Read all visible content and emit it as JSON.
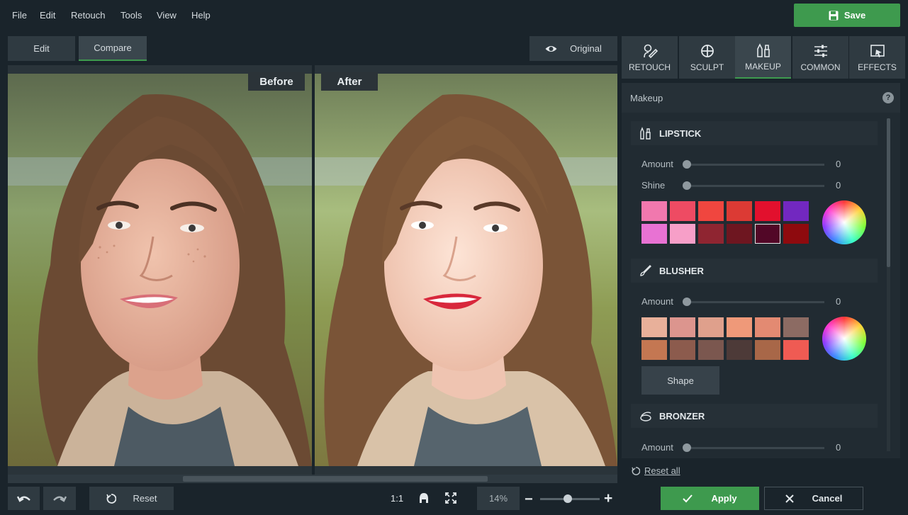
{
  "menu": [
    "File",
    "Edit",
    "Retouch",
    "Tools",
    "View",
    "Help"
  ],
  "save_label": "Save",
  "view_tabs": {
    "edit": "Edit",
    "compare": "Compare"
  },
  "original_label": "Original",
  "viewer": {
    "before_label": "Before",
    "after_label": "After"
  },
  "tool_tabs": [
    {
      "label": "RETOUCH",
      "icon": "retouch-icon"
    },
    {
      "label": "SCULPT",
      "icon": "sculpt-icon"
    },
    {
      "label": "MAKEUP",
      "icon": "makeup-icon",
      "active": true
    },
    {
      "label": "COMMON",
      "icon": "sliders-icon"
    },
    {
      "label": "EFFECTS",
      "icon": "effects-icon"
    }
  ],
  "panel": {
    "title": "Makeup",
    "help": "?",
    "lipstick": {
      "title": "LIPSTICK",
      "amount_label": "Amount",
      "amount_value": "0",
      "shine_label": "Shine",
      "shine_value": "0",
      "swatches": [
        "#f178ae",
        "#ee4b63",
        "#f0463f",
        "#dc3a34",
        "#e2102d",
        "#7228c0",
        "#e872d3",
        "#f79fc8",
        "#8f2531",
        "#6e1620",
        "#520727",
        "#8e0a0e"
      ],
      "selected_swatch": 10
    },
    "blusher": {
      "title": "BLUSHER",
      "amount_label": "Amount",
      "amount_value": "0",
      "swatches": [
        "#e8b09a",
        "#dc958e",
        "#dfa08c",
        "#ef9979",
        "#e38a72",
        "#8c6b63",
        "#c47752",
        "#8c5b4d",
        "#7b574f",
        "#4d3a38",
        "#a86748",
        "#ef5b53"
      ],
      "shape_label": "Shape"
    },
    "bronzer": {
      "title": "BRONZER",
      "amount_label": "Amount",
      "amount_value": "0"
    }
  },
  "reset_all_label": "Reset all",
  "bottom": {
    "reset_label": "Reset",
    "one_to_one": "1:1",
    "zoom": "14%"
  },
  "apply_label": "Apply",
  "cancel_label": "Cancel",
  "colors": {
    "accent": "#3e9a4e",
    "bg": "#1a242b",
    "panel": "#212b32"
  }
}
